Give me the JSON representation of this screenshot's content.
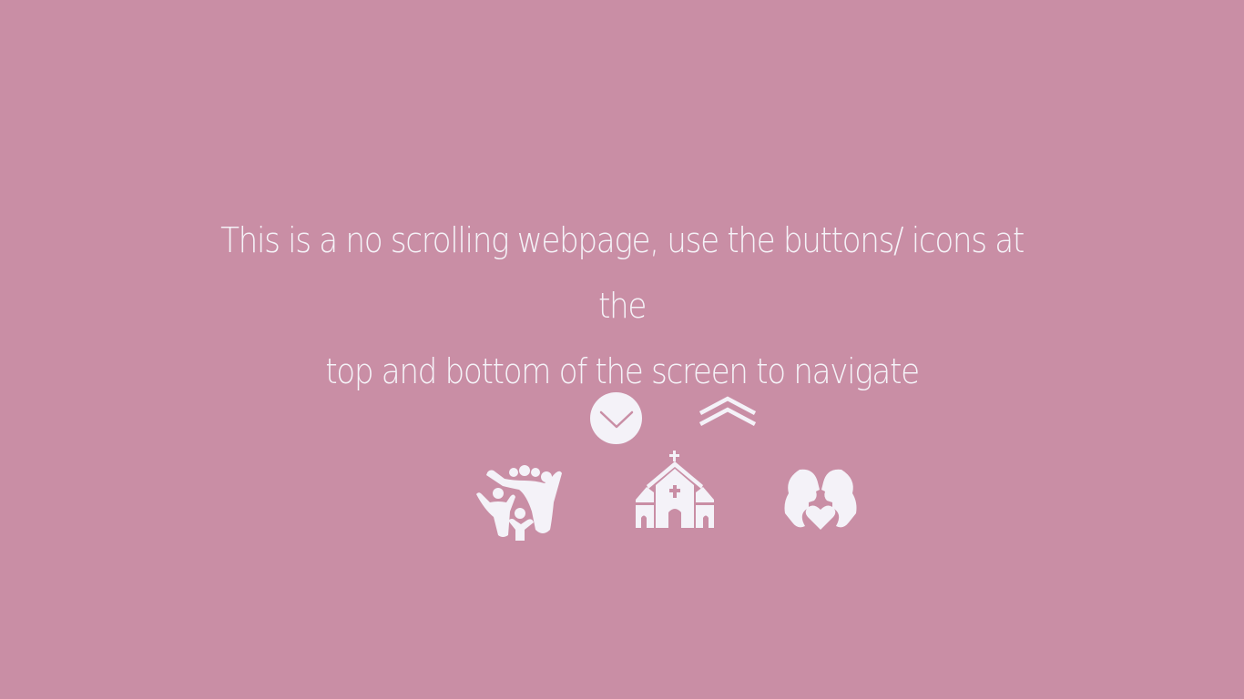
{
  "page": {
    "background_color": "#c98ea5",
    "foreground_color": "#f4f2f8"
  },
  "message": {
    "line1": "This is a no scrolling webpage, use the buttons/ icons at the",
    "line2": "top and bottom of the screen to navigate"
  },
  "navigation": {
    "buttons": [
      {
        "name": "scroll-down",
        "icon": "chevron-down-icon"
      },
      {
        "name": "scroll-up",
        "icon": "double-chevron-up-icon"
      }
    ],
    "icons": [
      {
        "name": "family",
        "icon": "family-icon"
      },
      {
        "name": "church",
        "icon": "church-icon"
      },
      {
        "name": "couple",
        "icon": "couple-heart-icon"
      }
    ]
  }
}
